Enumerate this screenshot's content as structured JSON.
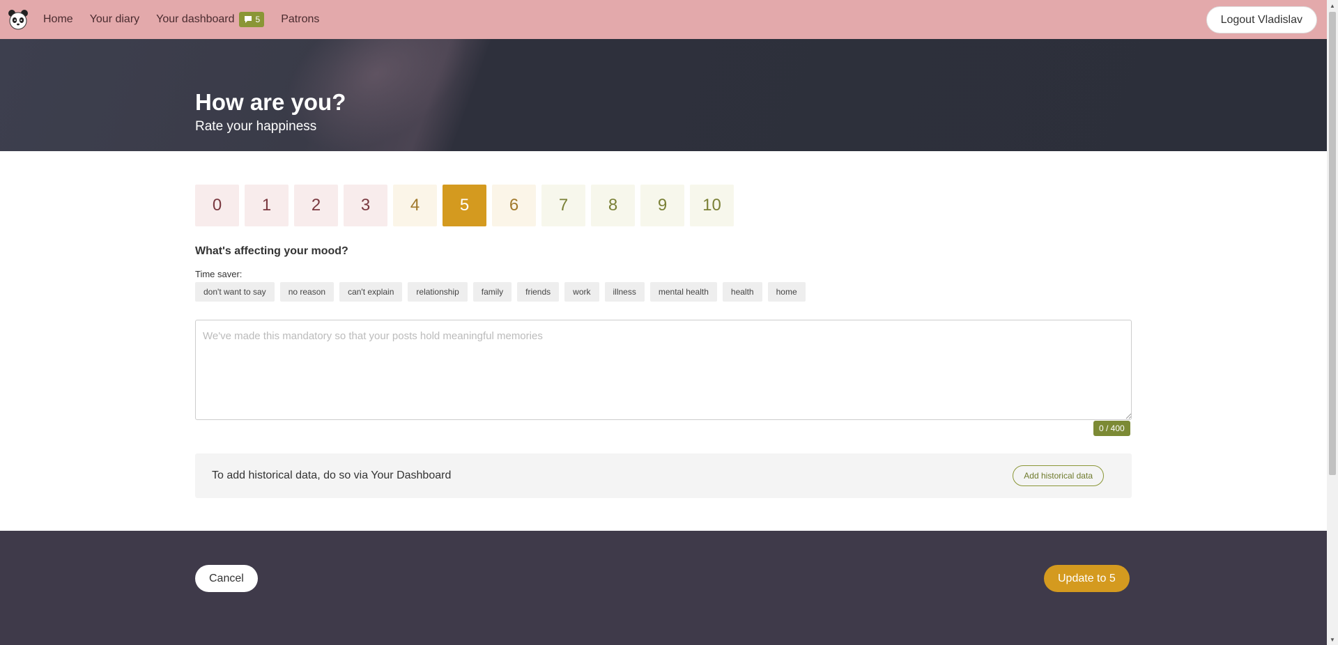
{
  "nav": {
    "logo_icon": "panda-logo-icon",
    "links": [
      "Home",
      "Your diary",
      "Your dashboard",
      "Patrons"
    ],
    "dashboard_badge_icon": "comment-icon",
    "dashboard_badge_count": "5",
    "logout_label": "Logout Vladislav"
  },
  "hero": {
    "title": "How are you?",
    "subtitle": "Rate your happiness"
  },
  "rating": {
    "options": [
      "0",
      "1",
      "2",
      "3",
      "4",
      "5",
      "6",
      "7",
      "8",
      "9",
      "10"
    ],
    "selected": "5"
  },
  "mood": {
    "heading": "What's affecting your mood?",
    "timesaver_label": "Time saver:",
    "tags": [
      "don't want to say",
      "no reason",
      "can't explain",
      "relationship",
      "family",
      "friends",
      "work",
      "illness",
      "mental health",
      "health",
      "home"
    ]
  },
  "entry": {
    "placeholder": "We've made this mandatory so that your posts hold meaningful memories",
    "value": "",
    "char_count": "0 / 400"
  },
  "history": {
    "text": "To add historical data, do so via Your Dashboard",
    "button_label": "Add historical data"
  },
  "footer": {
    "cancel_label": "Cancel",
    "update_label": "Update to 5"
  },
  "colors": {
    "navbar": "#e3a9ab",
    "accent_gold": "#d49a1f",
    "accent_olive": "#8a9636",
    "footer": "#3f3a4a",
    "hero": "#2c2f3a"
  }
}
